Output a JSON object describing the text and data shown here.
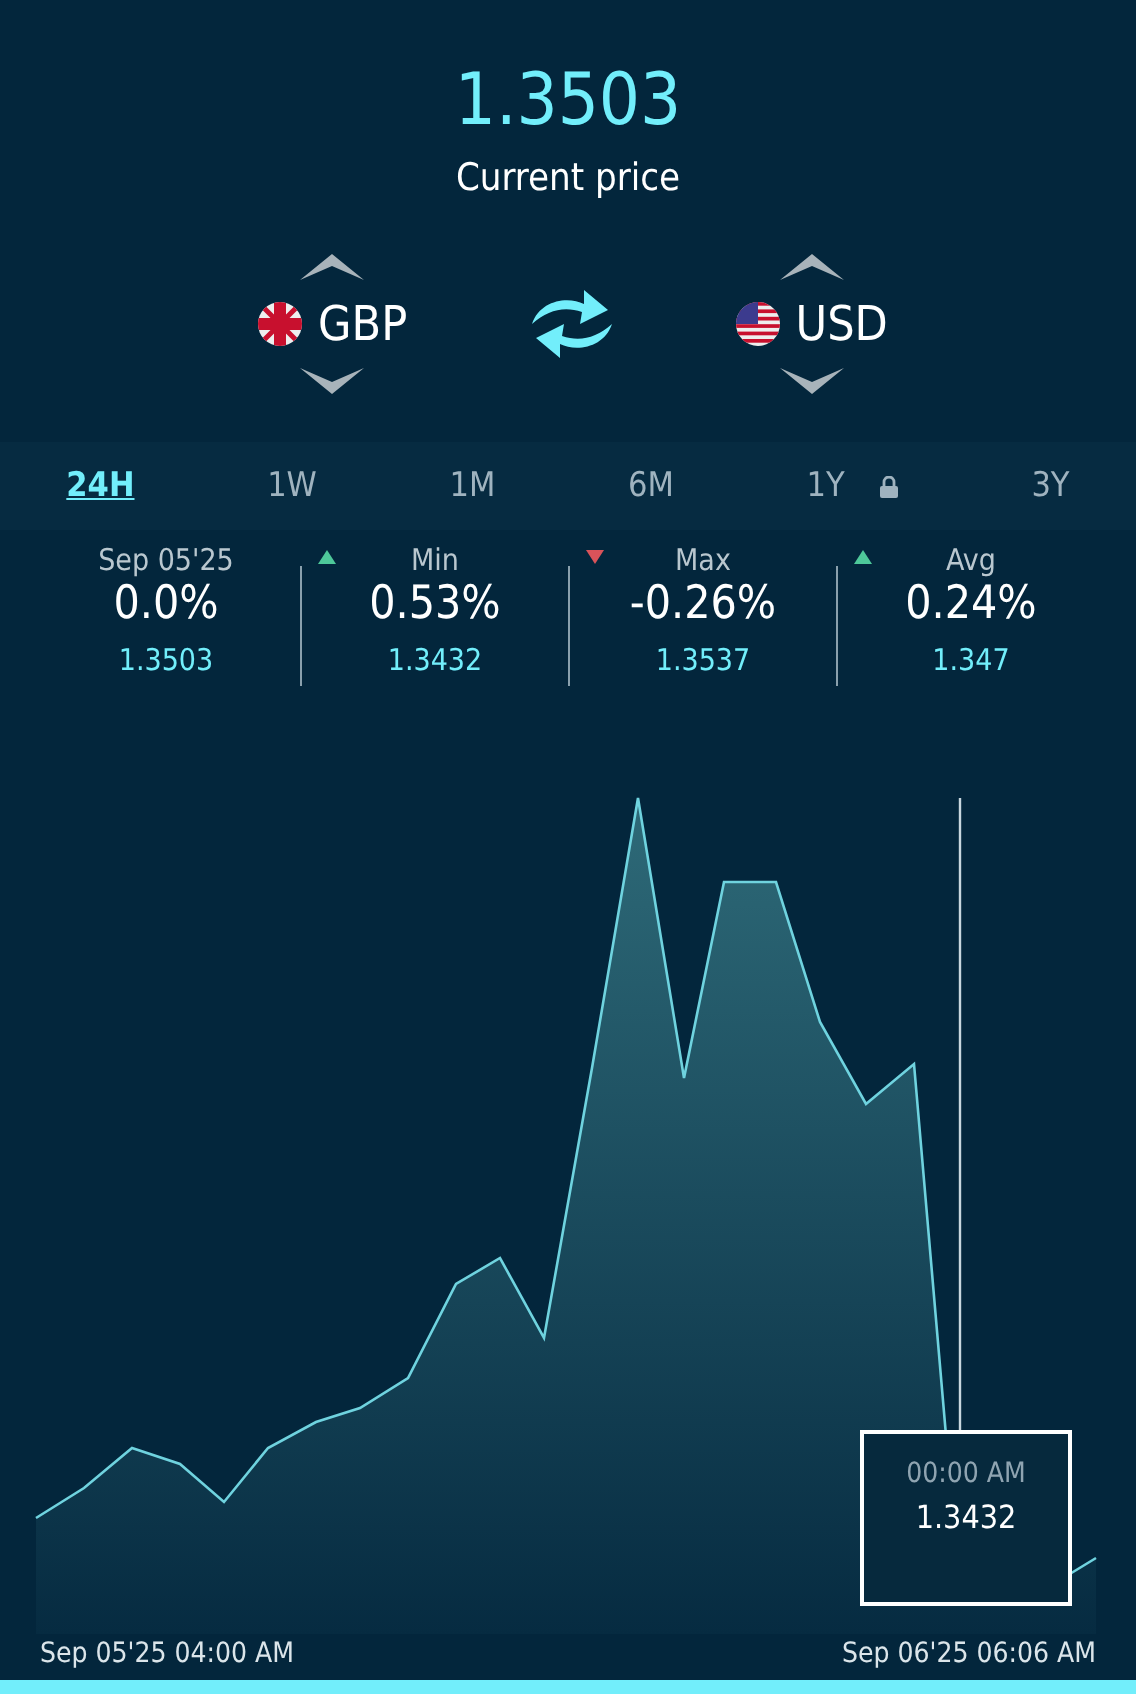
{
  "price": {
    "value": "1.3503",
    "label": "Current price"
  },
  "pair": {
    "from": {
      "code": "GBP",
      "kind": "gb"
    },
    "to": {
      "code": "USD",
      "kind": "us"
    }
  },
  "tabs": [
    {
      "label": "24H",
      "selected": true,
      "locked": false
    },
    {
      "label": "1W",
      "selected": false,
      "locked": false
    },
    {
      "label": "1M",
      "selected": false,
      "locked": false
    },
    {
      "label": "6M",
      "selected": false,
      "locked": false
    },
    {
      "label": "1Y",
      "selected": false,
      "locked": true
    },
    {
      "label": "3Y",
      "selected": false,
      "locked": false
    }
  ],
  "stats": [
    {
      "label": "Sep 05'25",
      "kind": "flat",
      "change": "0.0%",
      "rate": "1.3503"
    },
    {
      "label": "Min",
      "kind": "up",
      "change": "0.53%",
      "rate": "1.3432"
    },
    {
      "label": "Max",
      "kind": "down",
      "change": "-0.26%",
      "rate": "1.3537"
    },
    {
      "label": "Avg",
      "kind": "up",
      "change": "0.24%",
      "rate": "1.347"
    }
  ],
  "chart": {
    "tooltip": {
      "time": "00:00 AM",
      "value": "1.3432"
    },
    "start_label": "Sep 05'25 04:00 AM",
    "end_label": "Sep 06'25 06:06 AM"
  }
}
